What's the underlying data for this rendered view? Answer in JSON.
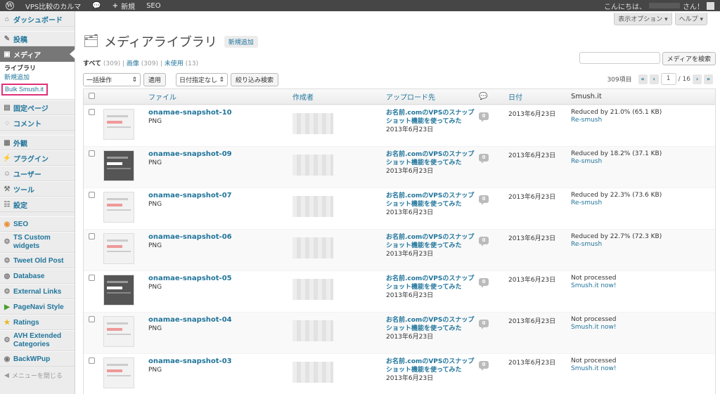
{
  "adminbar": {
    "site_name": "VPS比較のカルマ",
    "new_label": "新規",
    "seo_label": "SEO",
    "greeting": "こんにちは、",
    "user_suffix": "さん！"
  },
  "sidebar": {
    "dashboard": "ダッシュボード",
    "posts": "投稿",
    "media": "メディア",
    "media_sub": {
      "library": "ライブラリ",
      "add_new": "新規追加",
      "bulk_smush": "Bulk Smush.it"
    },
    "pages": "固定ページ",
    "comments": "コメント",
    "appearance": "外観",
    "plugins": "プラグイン",
    "users": "ユーザー",
    "tools": "ツール",
    "settings": "設定",
    "seo": "SEO",
    "ts_custom": "TS Custom widgets",
    "tweet_old": "Tweet Old Post",
    "database": "Database",
    "external_links": "External Links",
    "pagenavi": "PageNavi Style",
    "ratings": "Ratings",
    "avh": "AVH Extended Categories",
    "backwpup": "BackWPup",
    "collapse": "メニューを閉じる"
  },
  "screen": {
    "options_label": "表示オプション ▾",
    "help_label": "ヘルプ ▾"
  },
  "page": {
    "title": "メディアライブラリ",
    "add_new": "新規追加",
    "filter_all": "すべて",
    "filter_all_count": "(309)",
    "filter_images": "画像",
    "filter_images_count": "(309)",
    "filter_unattached": "未使用",
    "filter_unattached_count": "(13)",
    "search_button": "メディアを検索",
    "bulk_actions": "一括操作",
    "apply": "適用",
    "date_filter": "日付指定なし",
    "filter_button": "絞り込み検索",
    "items_count": "309項目",
    "current_page": "1",
    "total_pages": "/ 16"
  },
  "table": {
    "headers": {
      "file": "ファイル",
      "author": "作成者",
      "uploaded_to": "アップロード先",
      "date": "日付",
      "smush": "Smush.it"
    },
    "rows": [
      {
        "file": "onamae-snapshot-10",
        "type": "PNG",
        "parent": "お名前.comのVPSのスナップショット機能を使ってみた",
        "parent_date": "2013年6月23日",
        "comments": "0",
        "date": "2013年6月23日",
        "status": "Reduced by 21.0% (65.1 KB)",
        "action": "Re-smush",
        "dark": false
      },
      {
        "file": "onamae-snapshot-09",
        "type": "PNG",
        "parent": "お名前.comのVPSのスナップショット機能を使ってみた",
        "parent_date": "2013年6月23日",
        "comments": "0",
        "date": "2013年6月23日",
        "status": "Reduced by 18.2% (37.1 KB)",
        "action": "Re-smush",
        "dark": true
      },
      {
        "file": "onamae-snapshot-07",
        "type": "PNG",
        "parent": "お名前.comのVPSのスナップショット機能を使ってみた",
        "parent_date": "2013年6月23日",
        "comments": "0",
        "date": "2013年6月23日",
        "status": "Reduced by 22.3% (73.6 KB)",
        "action": "Re-smush",
        "dark": false
      },
      {
        "file": "onamae-snapshot-06",
        "type": "PNG",
        "parent": "お名前.comのVPSのスナップショット機能を使ってみた",
        "parent_date": "2013年6月23日",
        "comments": "0",
        "date": "2013年6月23日",
        "status": "Reduced by 22.7% (72.3 KB)",
        "action": "Re-smush",
        "dark": false
      },
      {
        "file": "onamae-snapshot-05",
        "type": "PNG",
        "parent": "お名前.comのVPSのスナップショット機能を使ってみた",
        "parent_date": "2013年6月23日",
        "comments": "0",
        "date": "2013年6月23日",
        "status": "Not processed",
        "action": "Smush.it now!",
        "dark": true
      },
      {
        "file": "onamae-snapshot-04",
        "type": "PNG",
        "parent": "お名前.comのVPSのスナップショット機能を使ってみた",
        "parent_date": "2013年6月23日",
        "comments": "0",
        "date": "2013年6月23日",
        "status": "Not processed",
        "action": "Smush.it now!",
        "dark": false
      },
      {
        "file": "onamae-snapshot-03",
        "type": "PNG",
        "parent": "お名前.comのVPSのスナップショット機能を使ってみた",
        "parent_date": "2013年6月23日",
        "comments": "0",
        "date": "2013年6月23日",
        "status": "Not processed",
        "action": "Smush.it now!",
        "dark": false
      }
    ]
  }
}
